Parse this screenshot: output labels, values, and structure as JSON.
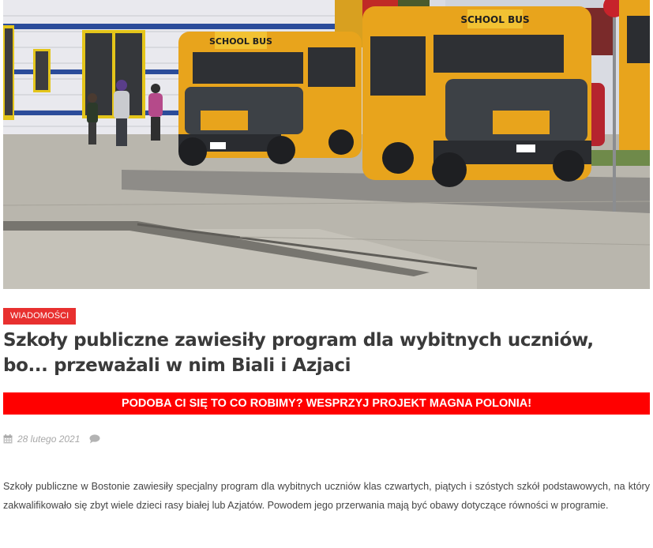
{
  "hero_image": {
    "sign_bus_left": "SCHOOL BUS",
    "sign_bus_right": "SCHOOL BUS",
    "colors": {
      "bus_yellow": "#e8a41c",
      "pavement": "#b9b6ad",
      "wall_blue": "#2b4c9a"
    }
  },
  "article": {
    "category": "WIADOMOŚCI",
    "title": "Szkoły publiczne zawiesiły program dla wybitnych uczniów, bo... przeważali w nim Biali i Azjaci",
    "support_banner": "PODOBA CI SIĘ TO CO ROBIMY? WESPRZYJ PROJEKT MAGNA POLONIA!",
    "date": "28 lutego 2021",
    "body": "Szkoły publiczne w Bostonie zawiesiły specjalny program dla wybitnych uczniów klas czwartych, piątych i szóstych szkół podstawowych, na który zakwalifikowało się zbyt wiele dzieci rasy białej lub Azjatów. Powodem jego przerwania mają być obawy dotyczące równości w programie.",
    "icons": {
      "date": "calendar-icon",
      "comments": "comment-icon"
    }
  },
  "colors": {
    "accent": "#e8302f",
    "banner": "#ff0000",
    "title": "#3a3a3a",
    "meta": "#a8a8a8"
  }
}
